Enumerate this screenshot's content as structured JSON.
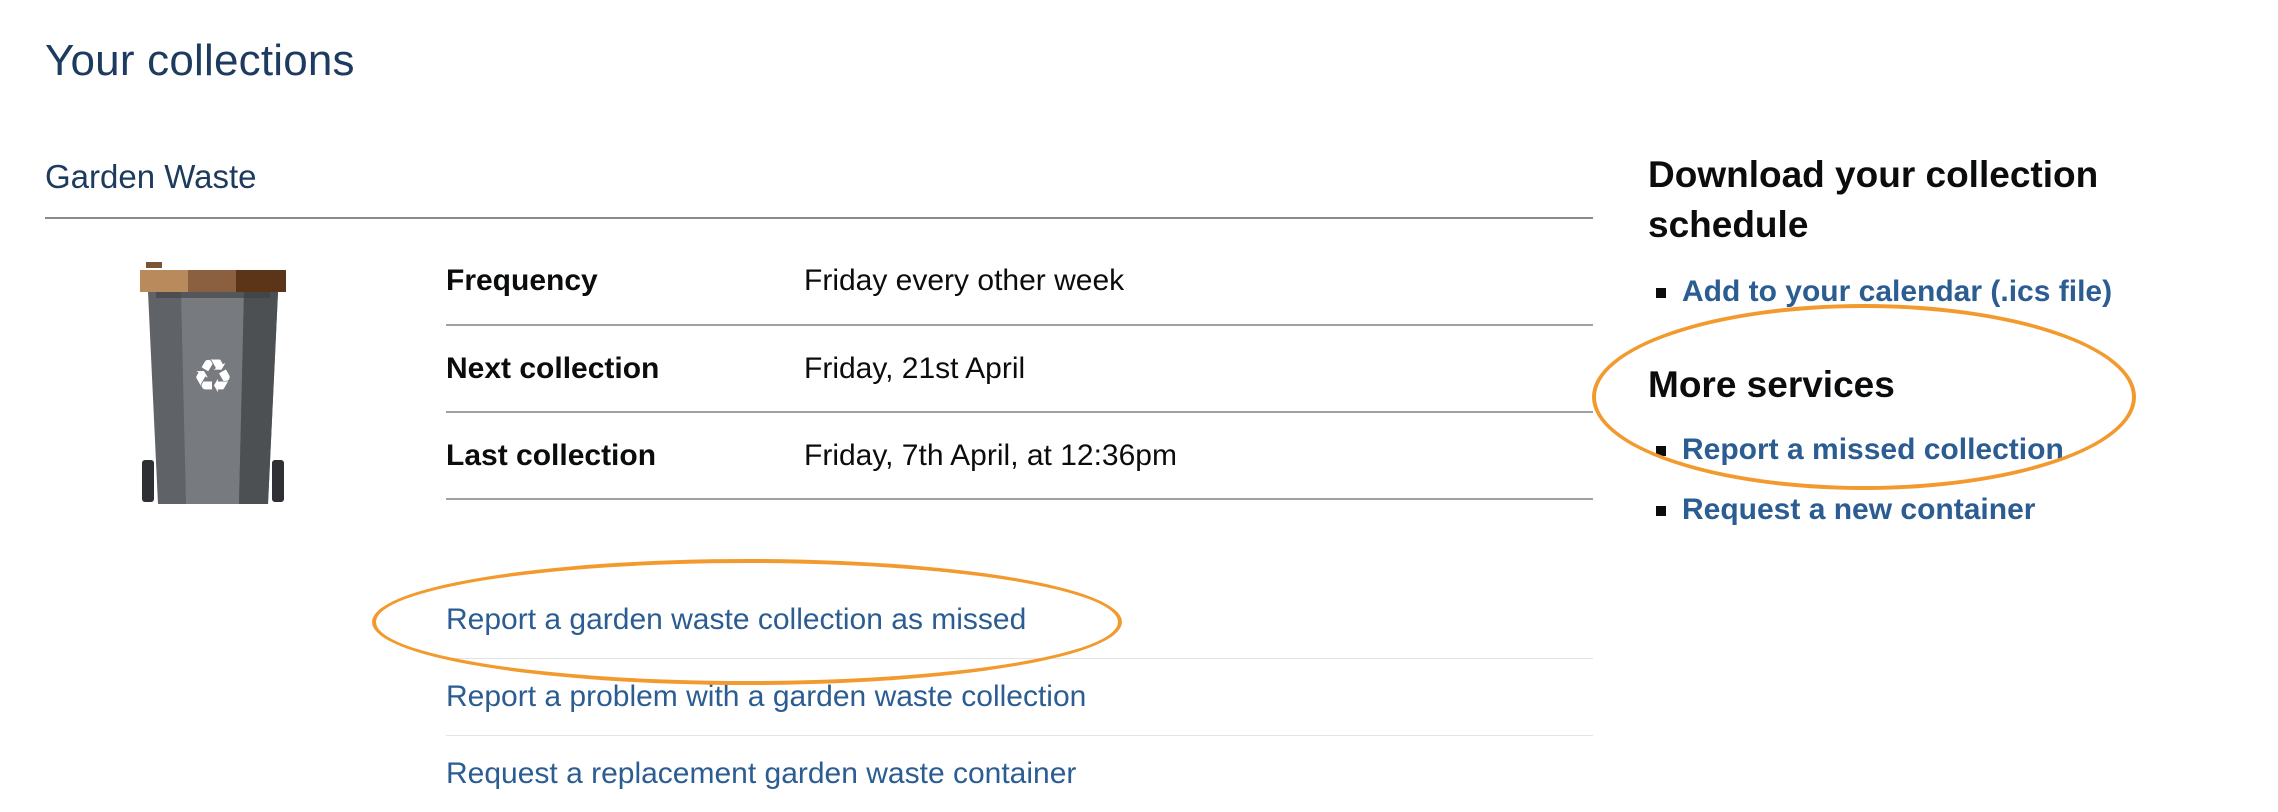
{
  "page": {
    "title": "Your collections"
  },
  "service": {
    "name": "Garden Waste",
    "bin_icon": "garden-waste-bin-icon",
    "summary": [
      {
        "label": "Frequency",
        "value": "Friday every other week"
      },
      {
        "label": "Next collection",
        "value": "Friday, 21st April"
      },
      {
        "label": "Last collection",
        "value": "Friday, 7th April, at 12:36pm"
      }
    ],
    "actions": [
      {
        "label": "Report a garden waste collection as missed"
      },
      {
        "label": "Report a problem with a garden waste collection"
      },
      {
        "label": "Request a replacement garden waste container"
      }
    ]
  },
  "sidebar": {
    "download": {
      "heading": "Download your collection schedule",
      "links": [
        {
          "label": "Add to your calendar (.ics file)"
        }
      ]
    },
    "more_services": {
      "heading": "More services",
      "links": [
        {
          "label": "Report a missed collection"
        },
        {
          "label": "Request a new container"
        }
      ]
    }
  },
  "colors": {
    "heading_blue": "#1d3b5e",
    "link_blue": "#2b5c92",
    "highlight_orange": "#f29a2e",
    "bin_body": "#5f6266",
    "bin_lid": "#8a5a2e"
  }
}
